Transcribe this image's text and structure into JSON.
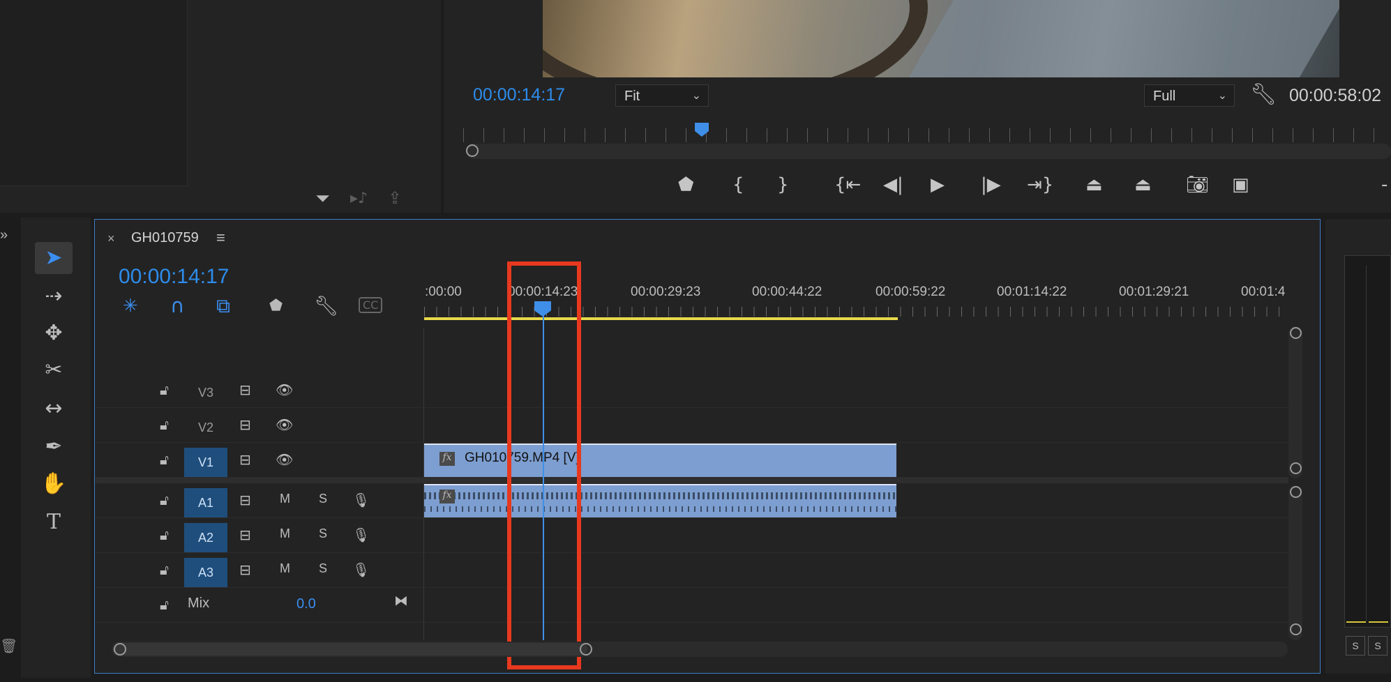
{
  "source_monitor": {
    "icons": [
      "filter-icon",
      "insert-audio-icon",
      "export-icon"
    ]
  },
  "program_monitor": {
    "timecode": "00:00:14:17",
    "fit_label": "Fit",
    "quality_label": "Full",
    "duration": "00:00:58:02",
    "controls": [
      "add-marker",
      "mark-in",
      "mark-out",
      "go-to-in",
      "step-back",
      "play",
      "step-forward",
      "go-to-out",
      "lift",
      "extract",
      "export-frame",
      "compare-view"
    ]
  },
  "timeline": {
    "sequence_name": "GH010759",
    "timecode": "00:00:14:17",
    "ruler_labels": [
      ":00:00",
      "00:00:14:23",
      "00:00:29:23",
      "00:00:44:22",
      "00:00:59:22",
      "00:01:14:22",
      "00:01:29:21",
      "00:01:4"
    ],
    "video_tracks": [
      {
        "name": "V3",
        "active": false
      },
      {
        "name": "V2",
        "active": false
      },
      {
        "name": "V1",
        "active": true
      }
    ],
    "audio_tracks": [
      {
        "name": "A1",
        "m": "M",
        "s": "S"
      },
      {
        "name": "A2",
        "m": "M",
        "s": "S"
      },
      {
        "name": "A3",
        "m": "M",
        "s": "S"
      }
    ],
    "mix_label": "Mix",
    "mix_value": "0.0",
    "video_clip": {
      "fx": "fx",
      "label": "GH010759.MP4 [V]"
    },
    "audio_clip": {
      "fx": "fx"
    }
  },
  "audio_meter": {
    "solo_labels": [
      "S",
      "S"
    ]
  },
  "highlight_color": "#e8391f",
  "accent_color": "#2d8ceb"
}
